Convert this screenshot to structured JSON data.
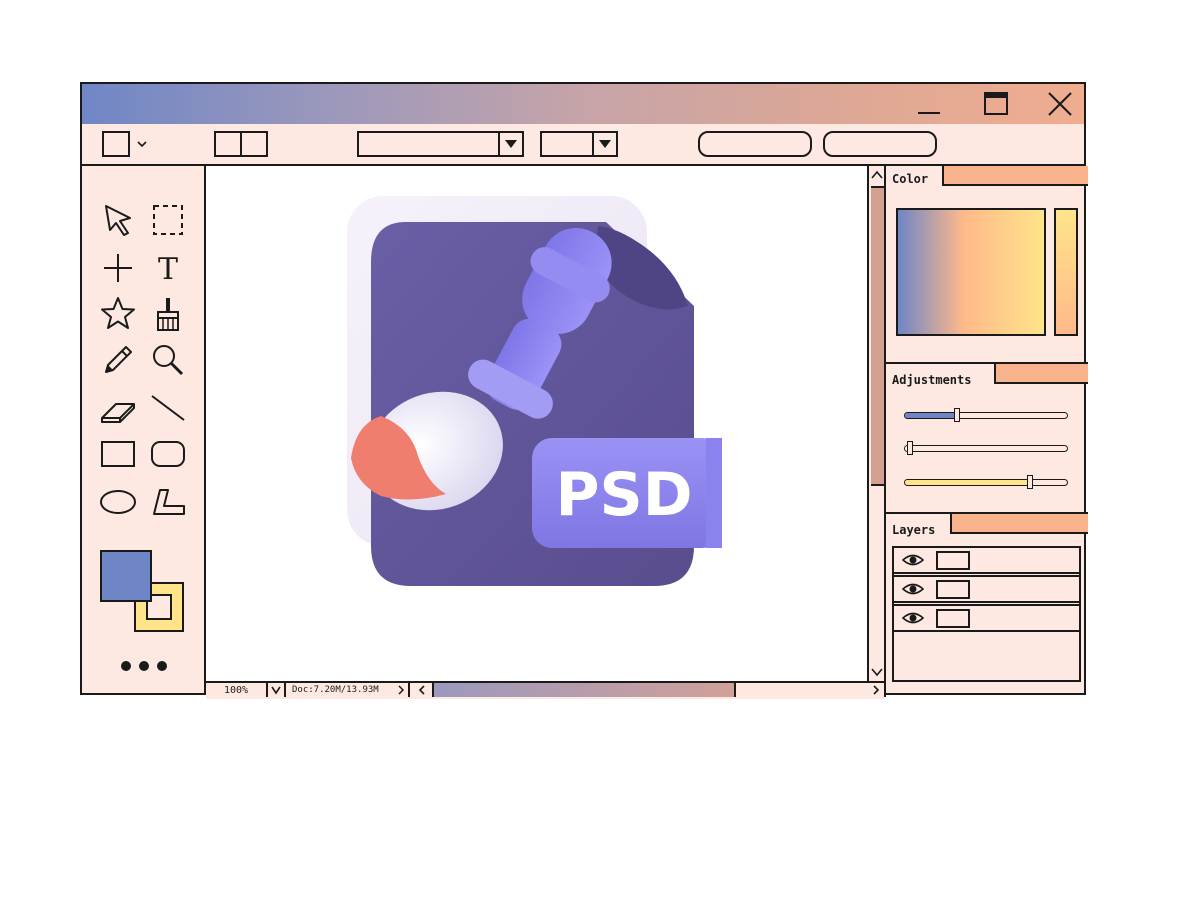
{
  "window": {
    "controls": [
      {
        "name": "minimize-button",
        "icon": "minimize-icon"
      },
      {
        "name": "maximize-button",
        "icon": "maximize-icon"
      },
      {
        "name": "close-button",
        "icon": "close-icon"
      }
    ]
  },
  "canvas": {
    "artwork_label": "PSD",
    "artwork_icon": "psd-file-with-paintbrush-icon"
  },
  "status": {
    "zoom": "100%",
    "doc_info": "Doc:7.20M/13.93M"
  },
  "panels": {
    "color": {
      "title": "Color",
      "gradient_colors": [
        "#6f86c6",
        "#ffb98a",
        "#ffe48a"
      ]
    },
    "adjustments": {
      "title": "Adjustments",
      "sliders": [
        {
          "color": "#6f86c6",
          "value": 0.33
        },
        {
          "color": "#ffffff",
          "value": 0.04
        },
        {
          "color": "#ffe48a",
          "value": 0.78
        }
      ]
    },
    "layers": {
      "title": "Layers",
      "items": [
        {
          "visible": true
        },
        {
          "visible": true
        },
        {
          "visible": true
        }
      ]
    }
  },
  "colors": {
    "accent": "#f9b38c",
    "foreground": "#6f86c6",
    "background": "#ffe48a",
    "window_bg": "#fde9e1",
    "outline": "#1a1a1a"
  }
}
